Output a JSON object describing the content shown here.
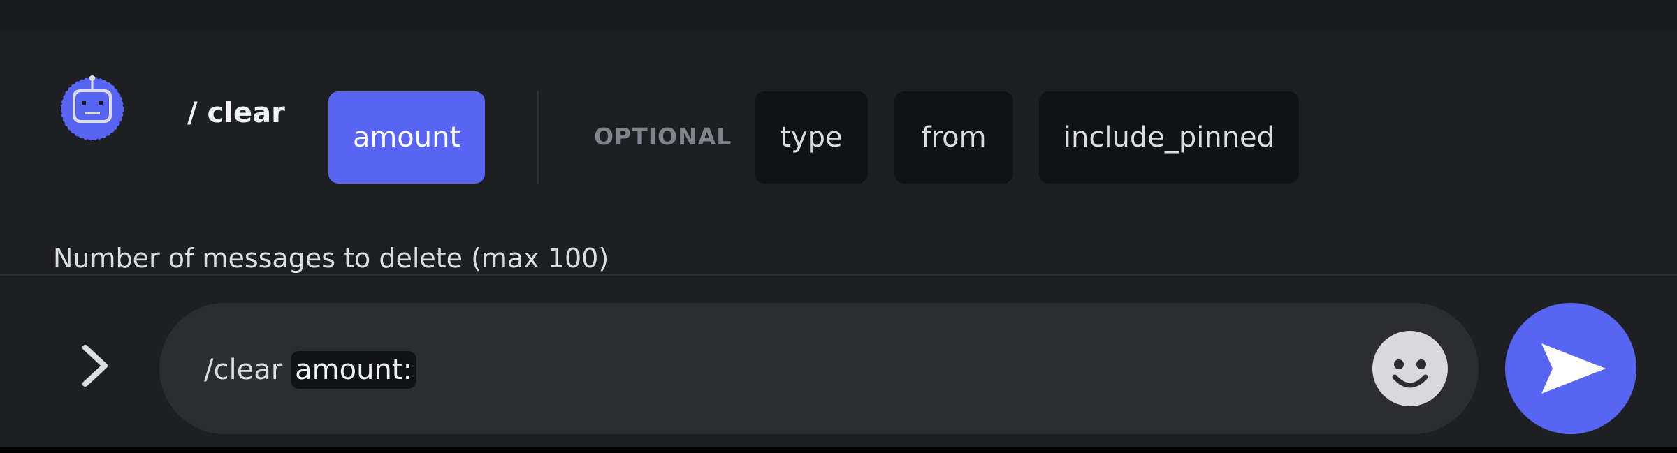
{
  "command": {
    "name": "/ clear",
    "required_options": [
      {
        "label": "amount",
        "selected": true
      }
    ],
    "optional_label": "OPTIONAL",
    "optional_options": [
      {
        "label": "type"
      },
      {
        "label": "from"
      },
      {
        "label": "include_pinned"
      }
    ],
    "description": "Number of messages to delete (max 100)"
  },
  "composer": {
    "command_text": "/clear",
    "option_token": "amount:",
    "icons": {
      "bot": "bot-avatar-icon",
      "prompt": "chevron-right-icon",
      "emoji": "smiley-face-icon",
      "send": "send-arrow-icon"
    }
  },
  "colors": {
    "accent": "#5865f2",
    "background": "#1e1f22",
    "chip": "#111214",
    "input": "#2b2d31"
  }
}
